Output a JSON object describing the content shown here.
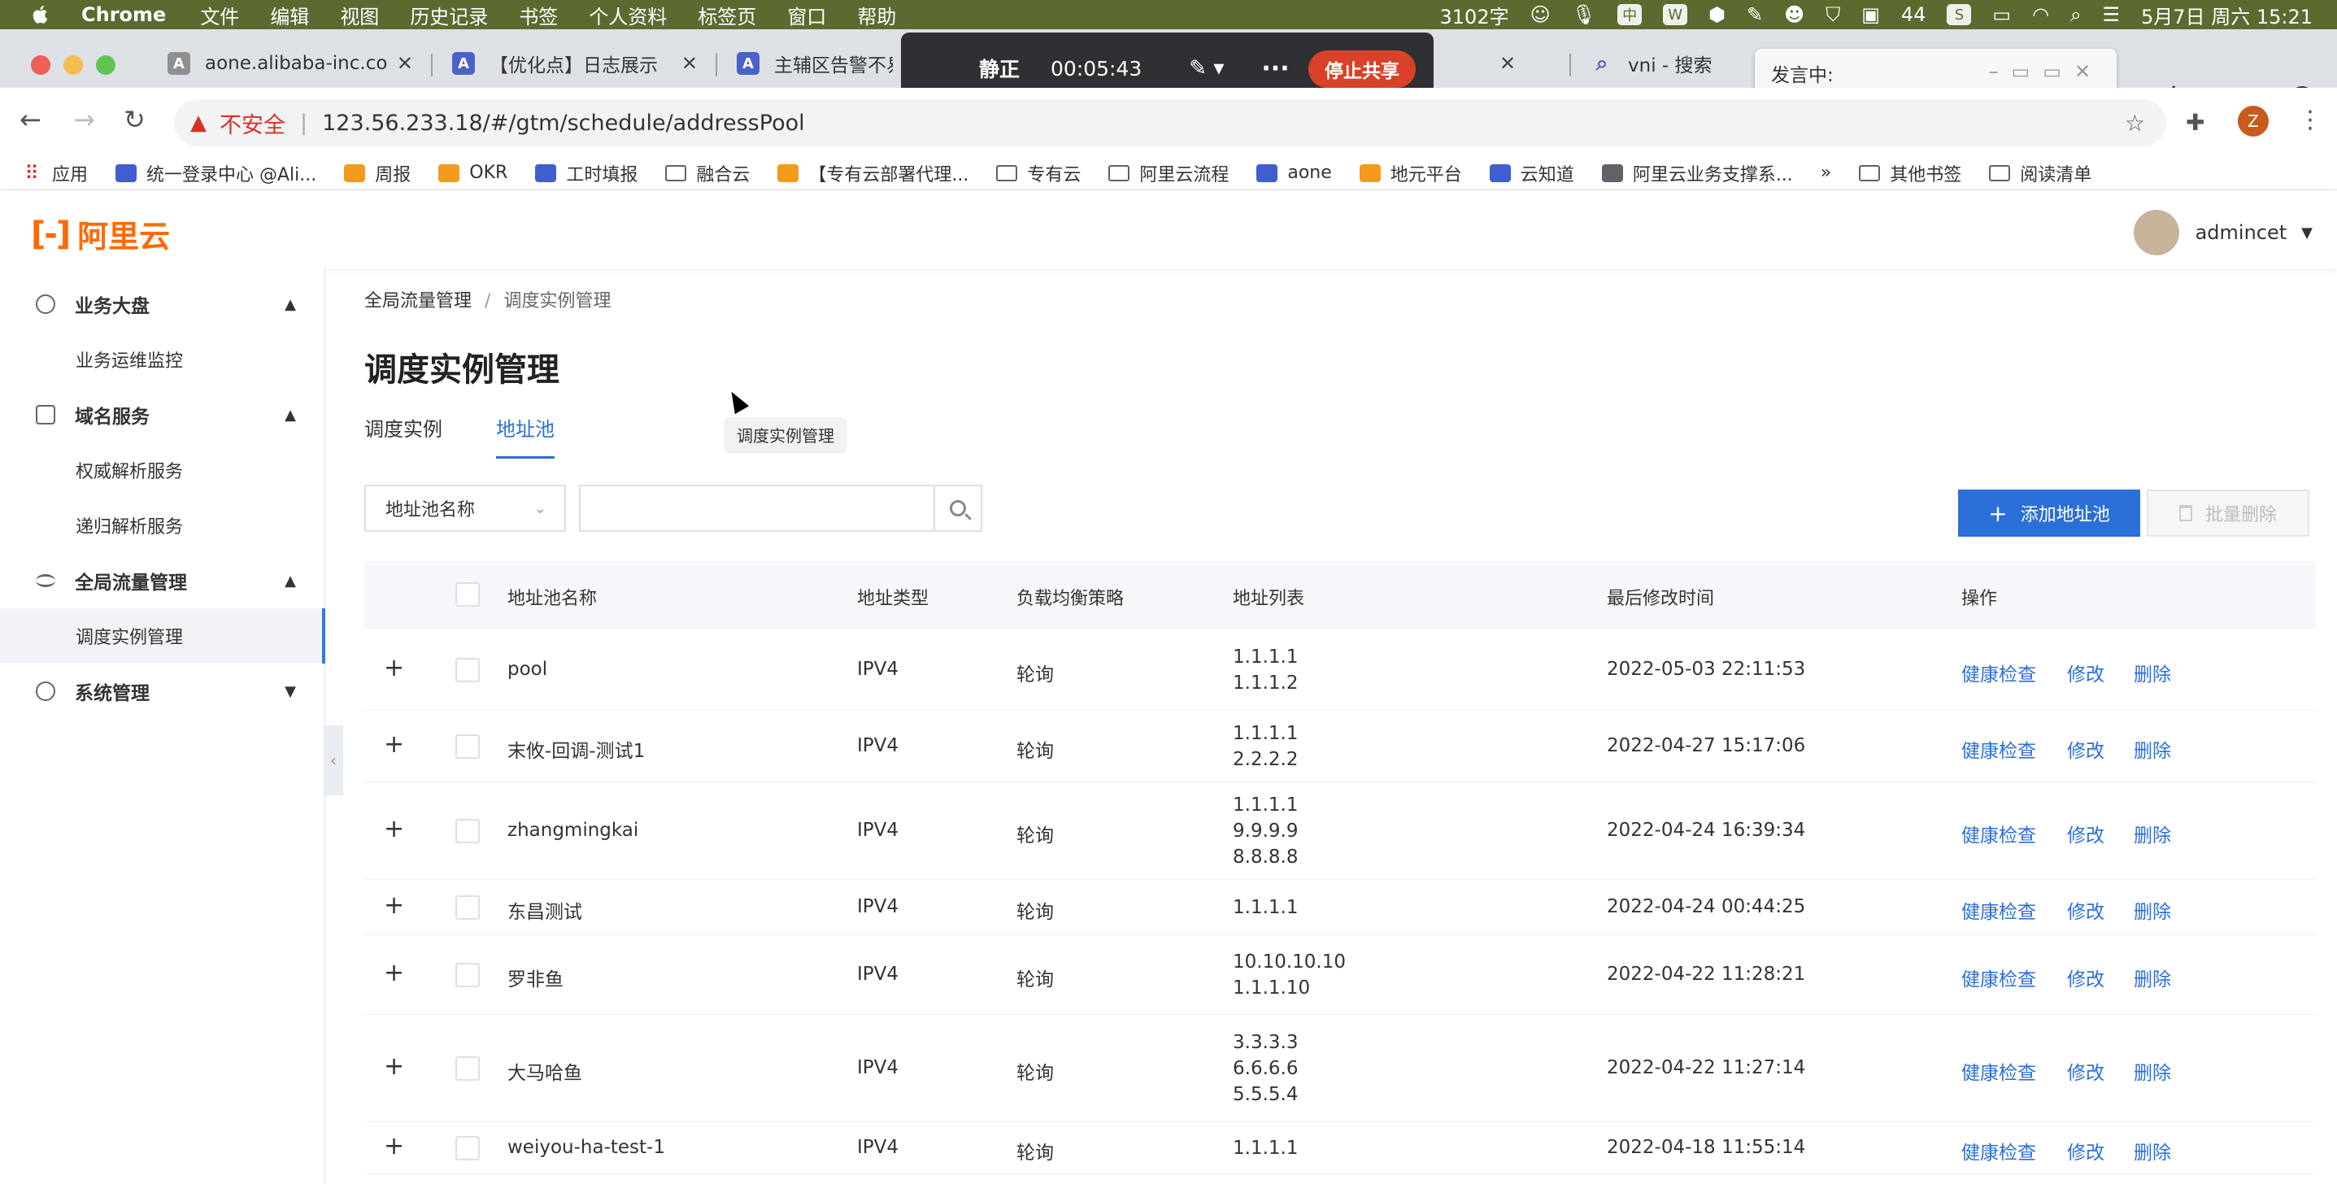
{
  "menubar": {
    "app_name": "Chrome",
    "menus": [
      "文件",
      "编辑",
      "视图",
      "历史记录",
      "书签",
      "个人资料",
      "标签页",
      "窗口",
      "帮助"
    ],
    "word_count": "3102字",
    "battery_badge": "44",
    "datetime": "5月7日 周六  15:21"
  },
  "browser": {
    "tabs": [
      {
        "title": "aone.alibaba-inc.com",
        "icon": "A"
      },
      {
        "title": "【优化点】日志展示",
        "icon": "A"
      },
      {
        "title": "主辅区告警不易",
        "icon": "A"
      },
      {
        "title": "vni - 搜索",
        "icon": "search"
      }
    ],
    "url": "123.56.233.18/#/gtm/schedule/addressPool",
    "insecure_label": "不安全",
    "profile_initial": "Z",
    "bookmarks": [
      "应用",
      "统一登录中心 @Ali...",
      "周报",
      "OKR",
      "工时填报",
      "融合云",
      "【专有云部署代理...",
      "专有云",
      "阿里云流程",
      "aone",
      "地元平台",
      "云知道",
      "阿里云业务支撑系..."
    ],
    "bookmarks_more": "»",
    "other_bookmarks": "其他书签",
    "reading_list": "阅读清单"
  },
  "screenshare": {
    "mute_label": "静正",
    "timer": "00:05:43",
    "stop_label": "停止共享",
    "speaking_label": "发言中:"
  },
  "console": {
    "logo_text": "阿里云",
    "username": "admincet",
    "sidebar": {
      "groups": [
        {
          "label": "业务大盘",
          "items": [
            "业务运维监控"
          ]
        },
        {
          "label": "域名服务",
          "items": [
            "权威解析服务",
            "递归解析服务"
          ]
        },
        {
          "label": "全局流量管理",
          "items": [
            "调度实例管理"
          ]
        },
        {
          "label": "系统管理",
          "items": []
        }
      ]
    },
    "breadcrumb": [
      "全局流量管理",
      "调度实例管理"
    ],
    "page_title": "调度实例管理",
    "tabs": [
      "调度实例",
      "地址池"
    ],
    "active_tab": "地址池",
    "tooltip": "调度实例管理",
    "filter": {
      "select_value": "地址池名称",
      "input_value": ""
    },
    "add_button": "添加地址池",
    "batch_delete": "批量删除",
    "table": {
      "columns": [
        "地址池名称",
        "地址类型",
        "负载均衡策略",
        "地址列表",
        "最后修改时间",
        "操作"
      ],
      "actions": [
        "健康检查",
        "修改",
        "删除"
      ],
      "rows": [
        {
          "name": "pool",
          "type": "IPV4",
          "strategy": "轮询",
          "addresses": "1.1.1.1\n1.1.1.2",
          "modified": "2022-05-03 22:11:53"
        },
        {
          "name": "末攸-回调-测试1",
          "type": "IPV4",
          "strategy": "轮询",
          "addresses": "1.1.1.1\n2.2.2.2",
          "modified": "2022-04-27 15:17:06"
        },
        {
          "name": "zhangmingkai",
          "type": "IPV4",
          "strategy": "轮询",
          "addresses": "1.1.1.1\n9.9.9.9\n8.8.8.8",
          "modified": "2022-04-24 16:39:34"
        },
        {
          "name": "东昌测试",
          "type": "IPV4",
          "strategy": "轮询",
          "addresses": "1.1.1.1",
          "modified": "2022-04-24 00:44:25"
        },
        {
          "name": "罗非鱼",
          "type": "IPV4",
          "strategy": "轮询",
          "addresses": "10.10.10.10\n1.1.1.10",
          "modified": "2022-04-22 11:28:21"
        },
        {
          "name": "大马哈鱼",
          "type": "IPV4",
          "strategy": "轮询",
          "addresses": "3.3.3.3\n6.6.6.6\n5.5.5.4",
          "modified": "2022-04-22 11:27:14"
        },
        {
          "name": "weiyou-ha-test-1",
          "type": "IPV4",
          "strategy": "轮询",
          "addresses": "1.1.1.1",
          "modified": "2022-04-18 11:55:14"
        }
      ]
    }
  },
  "colors": {
    "accent": "#2b6fd9",
    "brand": "#ff6a00",
    "menubar": "#5b6a2f",
    "stop": "#d9412b"
  }
}
